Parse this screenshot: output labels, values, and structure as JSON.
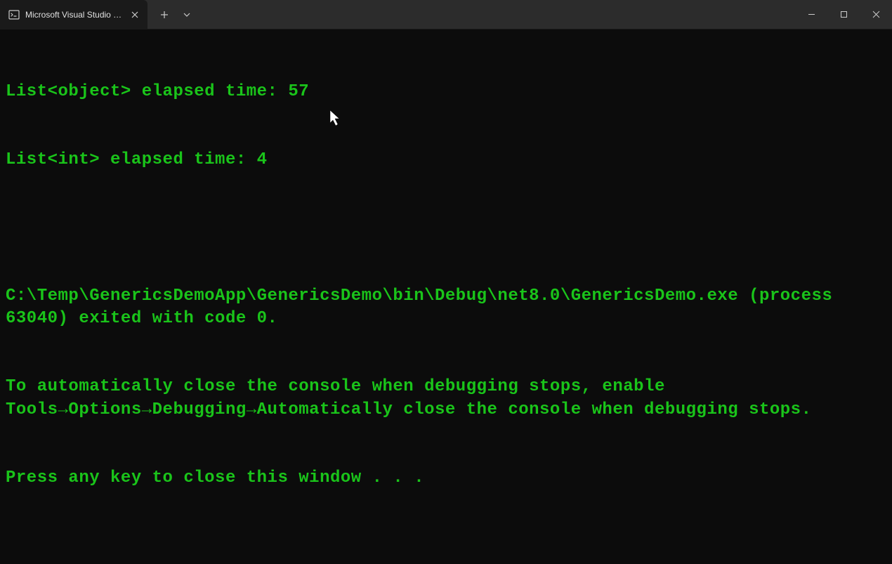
{
  "titlebar": {
    "tab_title": "Microsoft Visual Studio Debug"
  },
  "console": {
    "lines": [
      "List<object> elapsed time: 57",
      "List<int> elapsed time: 4",
      "",
      "C:\\Temp\\GenericsDemoApp\\GenericsDemo\\bin\\Debug\\net8.0\\GenericsDemo.exe (process 63040) exited with code 0.",
      "To automatically close the console when debugging stops, enable Tools→Options→Debugging→Automatically close the console when debugging stops.",
      "Press any key to close this window . . ."
    ]
  },
  "colors": {
    "console_text": "#1ac41a",
    "background": "#0c0c0c",
    "titlebar": "#2c2c2c"
  }
}
